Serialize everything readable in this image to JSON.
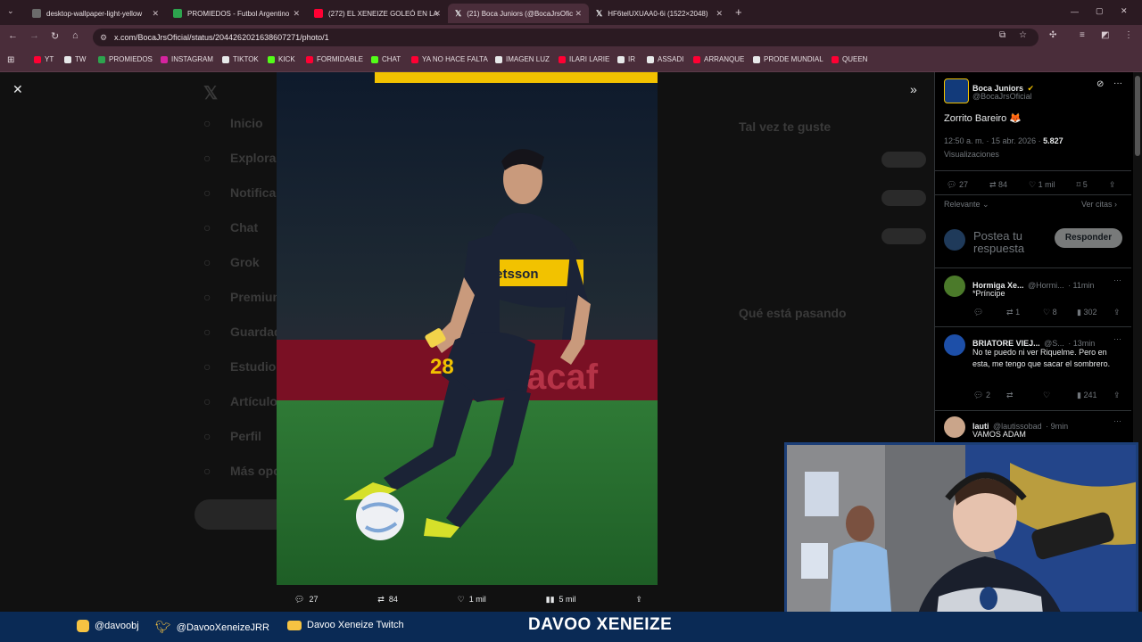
{
  "tabs": [
    {
      "title": "desktop-wallpaper-light-yellow",
      "color": "#6b6b6b"
    },
    {
      "title": "PROMIEDOS - Futbol Argentino",
      "color": "#2da44e"
    },
    {
      "title": "(272) EL XENEIZE GOLEÓ EN LA",
      "color": "#ff0033"
    },
    {
      "title": "(21) Boca Juniors (@BocaJrsOfic",
      "color": "#e7e9ea"
    },
    {
      "title": "HF6telUXUAA0-6i (1522×2048)",
      "color": "#e7e9ea"
    }
  ],
  "url": "x.com/BocaJrsOficial/status/2044262021638607271/photo/1",
  "bookmarks": [
    {
      "label": "YT",
      "color": "#ff0033"
    },
    {
      "label": "TW",
      "color": "#e7e9ea"
    },
    {
      "label": "PROMIEDOS",
      "color": "#2da44e"
    },
    {
      "label": "INSTAGRAM",
      "color": "#d6249f"
    },
    {
      "label": "TIKTOK",
      "color": "#e7e9ea"
    },
    {
      "label": "KICK",
      "color": "#53fc18"
    },
    {
      "label": "FORMIDABLE",
      "color": "#ff0033"
    },
    {
      "label": "CHAT",
      "color": "#53fc18"
    },
    {
      "label": "YA NO HACE FALTA",
      "color": "#ff0033"
    },
    {
      "label": "IMAGEN LUZ",
      "color": "#e7e9ea"
    },
    {
      "label": "ILARI LARIE",
      "color": "#ff0033"
    },
    {
      "label": "IR",
      "color": "#e7e9ea"
    },
    {
      "label": "ASSADI",
      "color": "#e7e9ea"
    },
    {
      "label": "ARRANQUE",
      "color": "#ff0033"
    },
    {
      "label": "PRODE MUNDIAL",
      "color": "#e7e9ea"
    },
    {
      "label": "QUEEN",
      "color": "#ff0033"
    }
  ],
  "background_nav": [
    "Inicio",
    "Explorar",
    "Notificaciones",
    "Chat",
    "Grok",
    "Premium",
    "Guardados",
    "Estudio de",
    "Artículos",
    "Perfil",
    "Más opciones"
  ],
  "background_side": {
    "suggest_title": "Tal vez te guste",
    "trends_title": "Qué está pasando"
  },
  "photo_bar": {
    "replies": "27",
    "reposts": "84",
    "likes": "1 mil",
    "views": "5 mil"
  },
  "post": {
    "name": "Boca Juniors",
    "handle": "@BocaJrsOficial",
    "text": "Zorrito Bareiro 🦊",
    "time": "12:50 a. m. · 15 abr. 2026 · ",
    "views": "5.827",
    "views_label": "Visualizaciones",
    "replies": "27",
    "reposts": "84",
    "likes": "1 mil",
    "bookmarks": "5",
    "sort": "Relevante",
    "quotes": "Ver citas",
    "compose_placeholder": "Postea tu respuesta",
    "reply_button": "Responder"
  },
  "replies": [
    {
      "name": "Hormiga Xe...",
      "handle": "@Hormi...",
      "time": "· 11min",
      "text": "*Príncipe",
      "reposts": "1",
      "likes": "8",
      "views": "302",
      "replies": ""
    },
    {
      "name": "BRIATORE VIEJ...",
      "handle": "@S...",
      "time": "· 13min",
      "text": "No te puedo ni ver Riquelme. Pero en esta, me tengo que sacar el sombrero.",
      "replies": "2",
      "reposts": "",
      "likes": "",
      "views": "241"
    },
    {
      "name": "lauti",
      "handle": "@lautissobad",
      "time": "· 9min",
      "text": "VAMOS ADAM"
    }
  ],
  "stream": {
    "instagram": "@davoobj",
    "twitter": "@DavooXeneizeJRR",
    "youtube": "Davoo Xeneize Twitch",
    "title": "DAVOO XENEIZE"
  },
  "photo_text": {
    "sponsor": "betsson",
    "number": "28"
  }
}
